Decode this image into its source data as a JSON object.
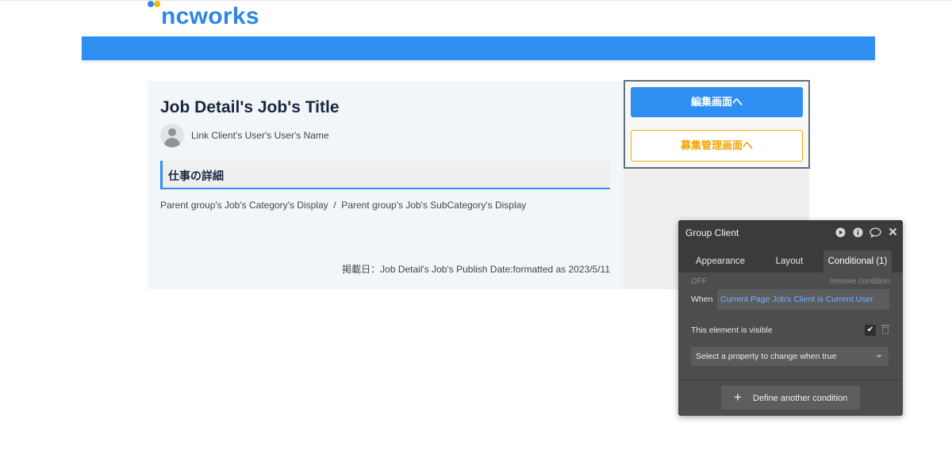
{
  "header": {
    "logo_text": "ncworks",
    "colors": {
      "brand_blue": "#2e8ff2",
      "dot_blue": "#2e86f0",
      "dot_yellow": "#f7b500"
    }
  },
  "job": {
    "title": "Job Detail's Job's Title",
    "user_name": "Link Client's User's User's Name",
    "section_heading": "仕事の詳細",
    "category_line": "Parent group's Job's Category's Display  /  Parent group's Job's SubCategory's Display",
    "publish_line": "掲載日：Job Detail's Job's Publish Date:formatted as 2023/5/11"
  },
  "actions": {
    "edit_label": "編集画面へ",
    "manage_label": "募集管理画面へ",
    "colors": {
      "edit_bg": "#2e8ff2",
      "manage_border": "#f5b100"
    }
  },
  "inspector": {
    "title": "Group Client",
    "icons": [
      "play-icon",
      "info-icon",
      "comment-icon",
      "close-icon"
    ],
    "tabs": [
      {
        "label": "Appearance"
      },
      {
        "label": "Layout"
      },
      {
        "label": "Conditional (1)",
        "active": true
      }
    ],
    "off_label": "OFF",
    "remove_condition": "remove condition",
    "when_label": "When",
    "when_value": "Current Page Job's Client is Current User",
    "visible_label": "This element is visible",
    "visible_checked": true,
    "property_select": "Select a property to change when true",
    "define_button": "Define another condition"
  }
}
